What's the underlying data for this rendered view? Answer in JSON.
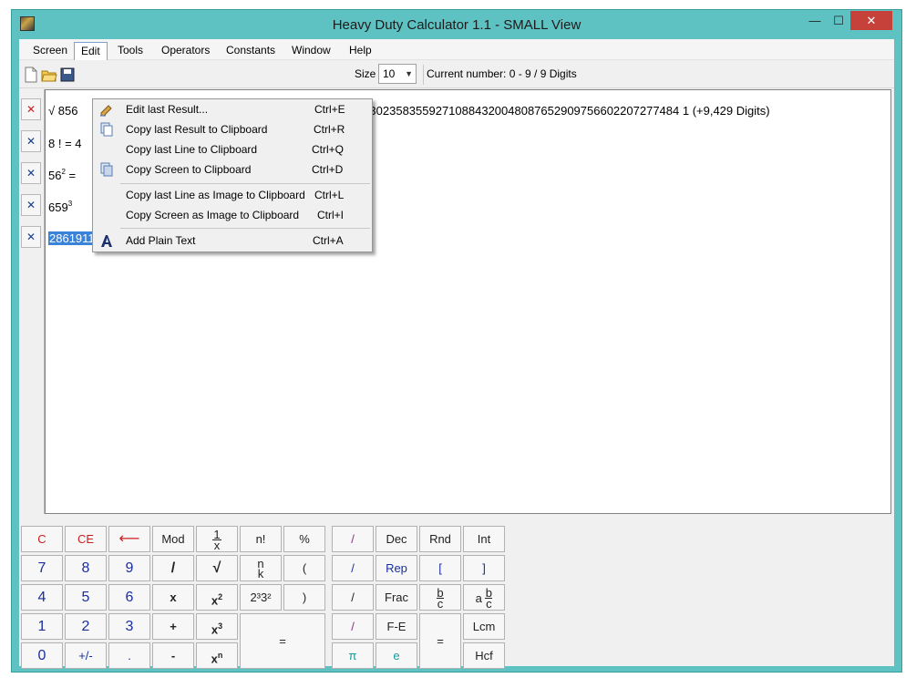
{
  "window": {
    "title": "Heavy Duty Calculator 1.1 - SMALL View",
    "minimize_glyph": "—",
    "maximize_glyph": "☐",
    "close_glyph": "✕",
    "icon": "app-icon"
  },
  "menubar": {
    "items": [
      "Screen",
      "Edit",
      "Tools",
      "Operators",
      "Constants",
      "Window",
      "Help"
    ],
    "active": "Edit"
  },
  "toolbar": {
    "icons": [
      "new-file-icon",
      "open-folder-icon",
      "save-icon"
    ],
    "size_label": "Size",
    "size_value": "10",
    "current_number": "Current number: 0 - 9 / 9 Digits"
  },
  "display": {
    "lines": [
      {
        "prefix": "√ 856",
        "tail": "339165304864130235835592710884320048087652909756602207277484 1  (+9,429  Digits)",
        "delete_glyph": "✕"
      },
      {
        "prefix": "8 ! = 4",
        "delete_glyph": "✕"
      },
      {
        "prefix": "56",
        "sup": "2",
        "suffix": " =",
        "delete_glyph": "✕"
      },
      {
        "prefix": "659",
        "sup": "3",
        "delete_glyph": "✕"
      },
      {
        "prefix": "286191179",
        "selected": true,
        "delete_glyph": "✕"
      }
    ]
  },
  "edit_menu": {
    "items": [
      {
        "label": "Edit last Result...",
        "accel": "Ctrl+E",
        "icon": "edit-pencil-icon"
      },
      {
        "label": "Copy last Result to Clipboard",
        "accel": "Ctrl+R",
        "icon": "copy-icon"
      },
      {
        "label": "Copy last Line to Clipboard",
        "accel": "Ctrl+Q"
      },
      {
        "label": "Copy Screen to Clipboard",
        "accel": "Ctrl+D",
        "icon": "copy-screen-icon"
      },
      {
        "label": "Copy last Line as Image to Clipboard",
        "accel": "Ctrl+L"
      },
      {
        "label": "Copy Screen as Image to Clipboard",
        "accel": "Ctrl+I"
      },
      {
        "label": "Add Plain Text",
        "accel": "Ctrl+A",
        "icon": "text-a-icon"
      }
    ]
  },
  "keypad": {
    "keys": [
      "C",
      "CE",
      "⟵",
      "Mod",
      "1/x",
      "n!",
      "%",
      "7",
      "8",
      "9",
      "/",
      "√",
      "(n k)",
      "(",
      "4",
      "5",
      "6",
      "x",
      "x²",
      "2³3²",
      ")",
      "1",
      "2",
      "3",
      "+",
      "x³",
      "=",
      "0",
      "+/-",
      ".",
      "-",
      "xⁿ",
      "/",
      "Dec",
      "Rnd",
      "Int",
      "/",
      "Rep",
      "[",
      "]",
      "/",
      "Frac",
      "b/c",
      "a b/c",
      "/",
      "F-E",
      "=",
      "Lcm",
      "π",
      "e",
      "Hcf"
    ],
    "frac_num": "1",
    "frac_den": "x",
    "binom_top": "n",
    "binom_bottom": "k",
    "bc_top": "b",
    "bc_bottom": "c",
    "abc_a": "a",
    "abc_b": "b",
    "abc_c": "c",
    "x_base": "x",
    "sq_exp": "2",
    "cube_exp": "3",
    "n_exp": "n"
  }
}
